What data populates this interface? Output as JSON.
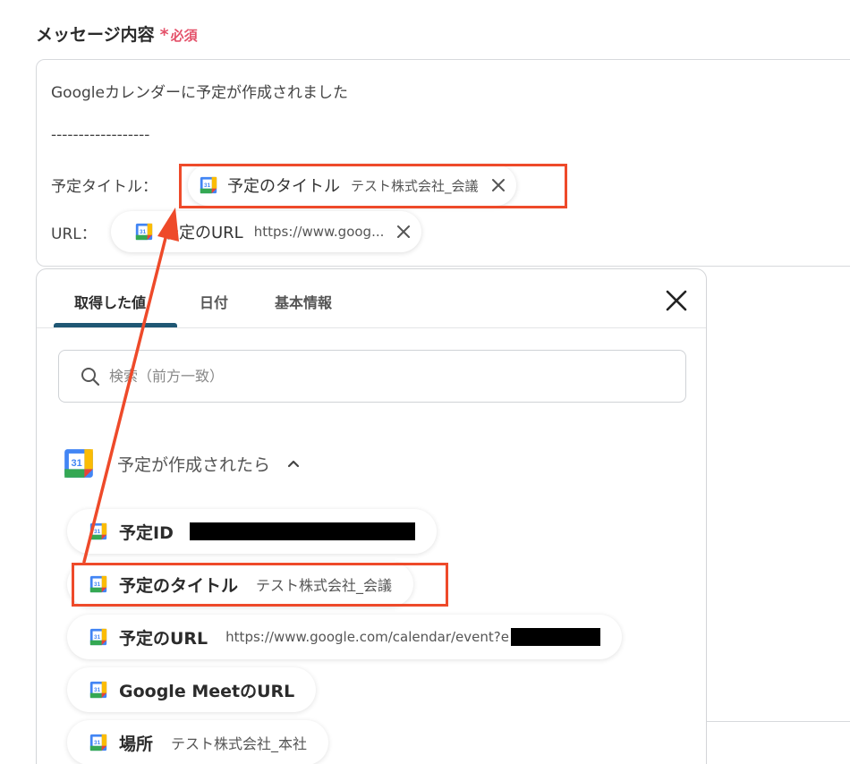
{
  "field": {
    "label": "メッセージ内容",
    "required_star": "*",
    "required_text": "必須"
  },
  "message": {
    "line1": "Googleカレンダーに予定が作成されました",
    "divider": "------------------",
    "title_prefix": "予定タイトル：",
    "url_prefix": "URL："
  },
  "chips": {
    "title": {
      "label": "予定のタイトル",
      "value": "テスト株式会社_会議"
    },
    "url": {
      "label": "予定のURL",
      "value": "https://www.goog..."
    }
  },
  "panel": {
    "tabs": [
      "取得した値",
      "日付",
      "基本情報"
    ],
    "active_tab": 0,
    "search_placeholder": "検索（前方一致）",
    "group_title": "予定が作成されたら",
    "items": [
      {
        "label": "予定ID",
        "value": ""
      },
      {
        "label": "予定のタイトル",
        "value": "テスト株式会社_会議"
      },
      {
        "label": "予定のURL",
        "value": "https://www.google.com/calendar/event?e"
      },
      {
        "label": "Google MeetのURL",
        "value": ""
      },
      {
        "label": "場所",
        "value": "テスト株式会社_本社"
      }
    ]
  },
  "colors": {
    "highlight": "#ee4a2a",
    "required": "#e4526a",
    "tab_accent": "#1f5774"
  },
  "icons": {
    "calendar": "google-calendar-icon",
    "close": "close-icon",
    "search": "search-icon",
    "chevron": "chevron-up-icon",
    "arrow": "annotation-arrow"
  }
}
